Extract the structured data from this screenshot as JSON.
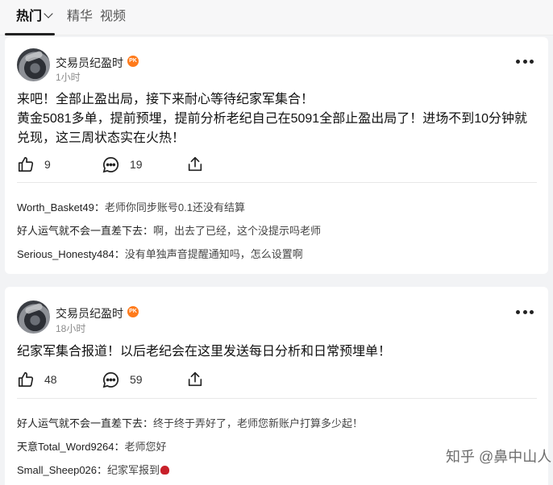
{
  "tabs": [
    {
      "label": "热门",
      "active": true
    },
    {
      "label": "精华",
      "active": false
    },
    {
      "label": "视频",
      "active": false
    }
  ],
  "posts": [
    {
      "author": "交易员纪盈时",
      "badge": "PK",
      "time": "1小时",
      "lines": [
        "来吧！全部止盈出局，接下来耐心等待纪家军集合！",
        "黄金5081多单，提前预埋，提前分析老纪自己在5091全部止盈出局了！进场不到10分钟就",
        "兑现，这三周状态实在火热！"
      ],
      "likes": "9",
      "comments": "19",
      "comment_list": [
        {
          "name": "Worth_Basket49",
          "sep": "：",
          "text": "老师你同步账号0.1还没有结算"
        },
        {
          "name": "好人运气就不会一直差下去",
          "sep": "：",
          "text": "啊，出去了已经，这个没提示吗老师"
        },
        {
          "name": "Serious_Honesty484",
          "sep": "：",
          "text": "没有单独声音提醒通知吗，怎么设置啊"
        }
      ]
    },
    {
      "author": "交易员纪盈时",
      "badge": "PK",
      "time": "18小时",
      "lines": [
        "纪家军集合报道！以后老纪会在这里发送每日分析和日常预埋单！"
      ],
      "likes": "48",
      "comments": "59",
      "comment_list": [
        {
          "name": "好人运气就不会一直差下去",
          "sep": "：",
          "text": "终于终于弄好了，老师您新账户打算多少起！"
        },
        {
          "name": "天意Total_Word9264",
          "sep": "：",
          "text": "老师您好"
        },
        {
          "name": "Small_Sheep026",
          "sep": "：",
          "text": "纪家军报到"
        }
      ]
    }
  ],
  "watermark": "知乎 @鼻中山人",
  "colors": {
    "badge": "#ff7a1a",
    "background": "#f2f3f5"
  }
}
